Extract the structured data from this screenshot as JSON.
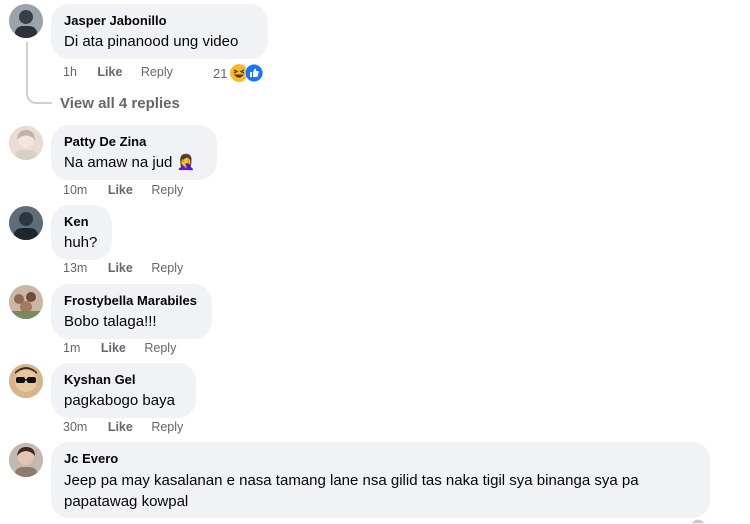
{
  "comments": [
    {
      "author": "Jasper Jabonillo",
      "text": "Di ata pinanood ung video",
      "time": "1h",
      "like": "Like",
      "reply": "Reply",
      "reaction_count": "21",
      "reactions": [
        "haha-icon",
        "like-icon"
      ],
      "view_replies": "View all 4 replies"
    },
    {
      "author": "Patty De Zina",
      "text": "Na amaw na jud 🤦‍♀️",
      "time": "10m",
      "like": "Like",
      "reply": "Reply"
    },
    {
      "author": "Ken",
      "text": "huh?",
      "time": "13m",
      "like": "Like",
      "reply": "Reply"
    },
    {
      "author": "Frostybella Marabiles",
      "text": "Bobo talaga!!!",
      "time": "1m",
      "like": "Like",
      "reply": "Reply"
    },
    {
      "author": "Kyshan Gel",
      "text": "pagkabogo baya",
      "time": "30m",
      "like": "Like",
      "reply": "Reply"
    },
    {
      "author": "Jc Evero",
      "text_line1": "Jeep pa may kasalanan e nasa tamang lane nsa gilid tas naka tigil sya binanga sya pa",
      "text_line2": "papatawag kowpal"
    }
  ],
  "colors": {
    "bubble": "#f0f2f5",
    "meta_text": "#65676b",
    "name_text": "#050505",
    "like_blue": "#1877f2",
    "haha_yellow": "#f7b928"
  }
}
